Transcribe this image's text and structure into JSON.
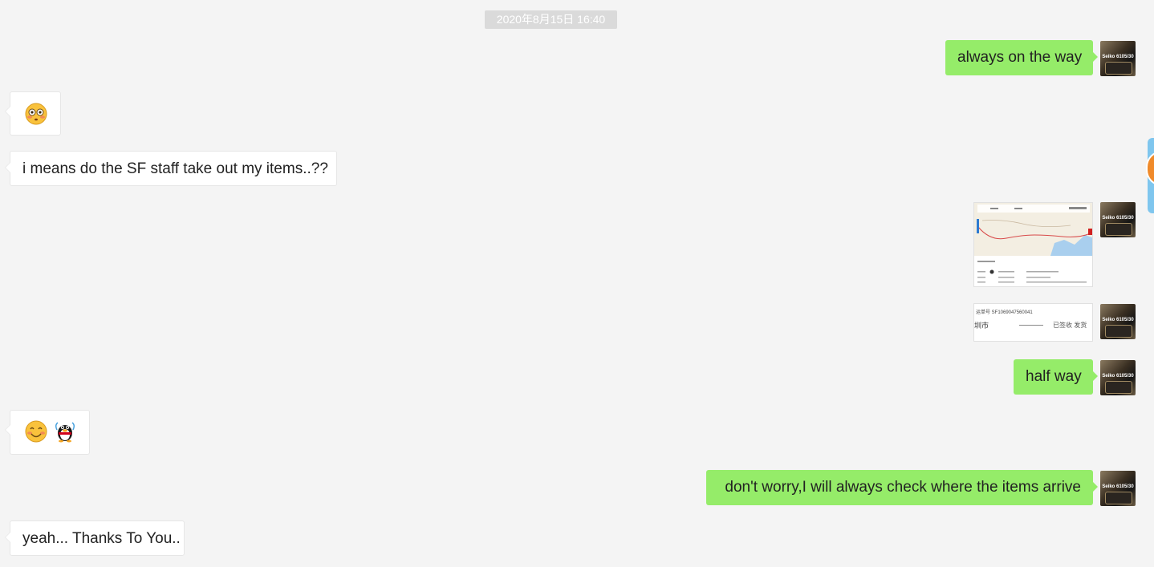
{
  "timestamp": "2020年8月15日 16:40",
  "messages": {
    "m1": "always on the way",
    "m3": "i means do the SF staff take out my items..??",
    "m6": "half way",
    "m8": "don't worry,I will always check where the items arrive",
    "m9": "yeah... Thanks To You.."
  },
  "avatar": {
    "caption": "Seiko 6105/30"
  },
  "images": {
    "tracking_number": "运单号 SF1069047560041",
    "city_fragment": "圳市",
    "stamp_text": "已签收 发货"
  },
  "icons": {
    "flushed": "flushed-face-icon",
    "smile": "smiling-face-icon",
    "penguin": "qq-penguin-icon"
  },
  "colors": {
    "outgoing_bubble": "#95ec69",
    "incoming_bubble": "#ffffff",
    "background": "#f4f4f4",
    "timestamp_bg": "#dadada"
  }
}
